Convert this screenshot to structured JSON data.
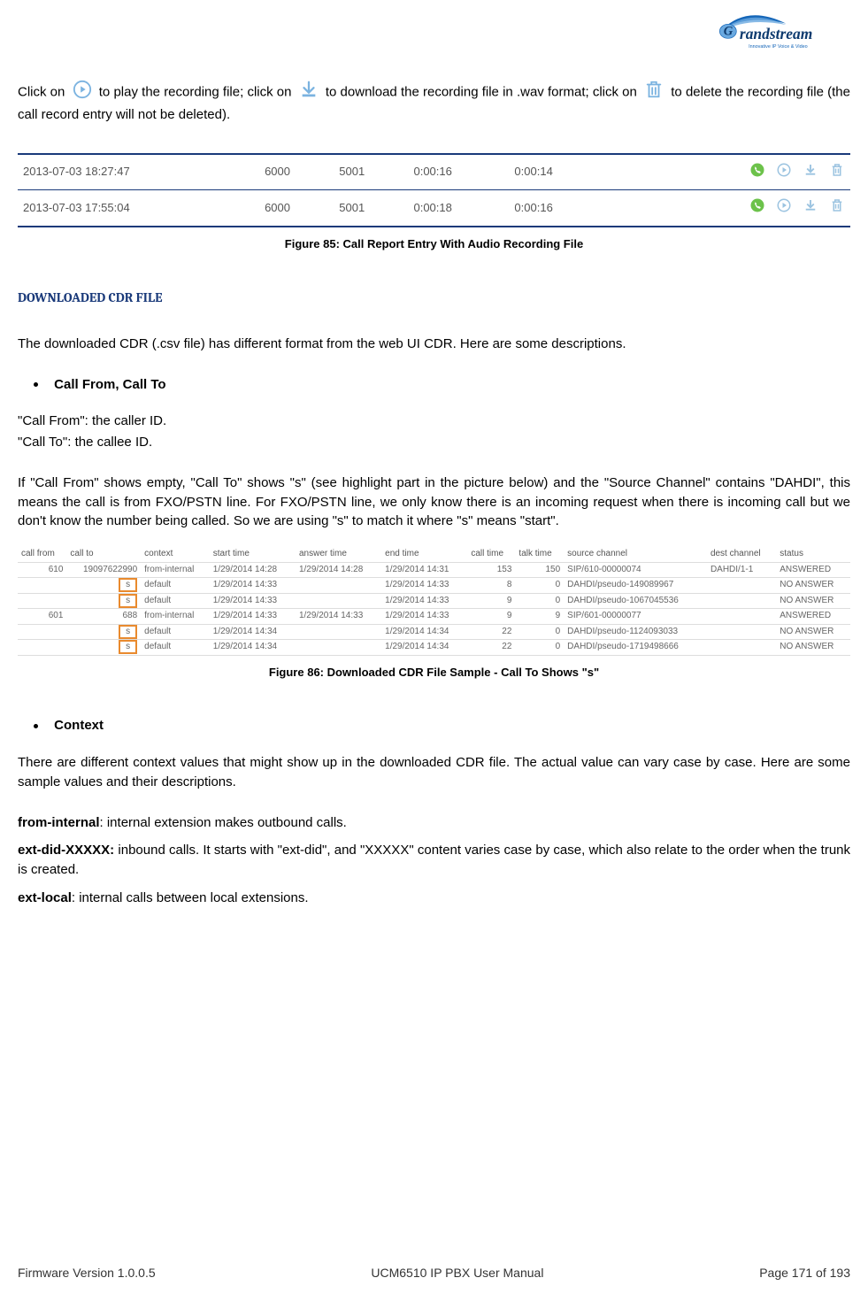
{
  "logo": {
    "brand": "Grandstream",
    "tagline": "Innovative IP Voice & Video"
  },
  "intro": {
    "t1": "Click on",
    "t2": " to play the recording file; click on",
    "t3": " to download the recording file in .wav format; click on",
    "t4": " to delete the recording file (the call record entry will not be deleted).",
    "icon_play": "play-circle-icon",
    "icon_download": "download-arrow-icon",
    "icon_delete": "trash-icon"
  },
  "fig85": {
    "caption": "Figure 85: Call Report Entry With Audio Recording File",
    "rows": [
      {
        "time": "2013-07-03 18:27:47",
        "from": "6000",
        "to": "5001",
        "d1": "0:00:16",
        "d2": "0:00:14"
      },
      {
        "time": "2013-07-03 17:55:04",
        "from": "6000",
        "to": "5001",
        "d1": "0:00:18",
        "d2": "0:00:16"
      }
    ]
  },
  "section": {
    "heading": "DOWNLOADED CDR FILE",
    "p1": "The downloaded CDR (.csv file) has different format from the web UI CDR. Here are some descriptions.",
    "bullet1": "Call From, Call To",
    "p2": "\"Call From\": the caller ID.",
    "p3": "\"Call To\": the callee ID.",
    "p4": "If \"Call From\" shows empty, \"Call To\" shows \"s\" (see highlight part in the picture below) and the \"Source Channel\" contains \"DAHDI\", this means the call is from FXO/PSTN line. For FXO/PSTN line, we only know there is an incoming request when there is incoming call but we don't know the number being called. So we are using \"s\" to match it where \"s\" means \"start\".",
    "bullet2": "Context",
    "p5": "There are different context values that might show up in the downloaded CDR file. The actual value can vary case by case. Here are some sample values and their descriptions.",
    "ctx1a": "from-internal",
    "ctx1b": ": internal extension makes outbound calls.",
    "ctx2a": "ext-did-XXXXX:",
    "ctx2b": " inbound calls. It starts with \"ext-did\", and \"XXXXX\" content varies case by case, which also relate to the order when the trunk is created.",
    "ctx3a": "ext-local",
    "ctx3b": ": internal calls between local extensions."
  },
  "fig86": {
    "caption": "Figure 86: Downloaded CDR File Sample - Call To Shows \"s\"",
    "headers": [
      "call from",
      "call to",
      "context",
      "start time",
      "answer time",
      "end time",
      "call time",
      "talk time",
      "source channel",
      "dest channel",
      "status"
    ],
    "rows": [
      {
        "from": "610",
        "to": "19097622990",
        "ctx": "from-internal",
        "st": "1/29/2014 14:28",
        "at": "1/29/2014 14:28",
        "et": "1/29/2014 14:31",
        "ct": "153",
        "tt": "150",
        "sc": "SIP/610-00000074",
        "dc": "DAHDI/1-1",
        "status": "ANSWERED",
        "hl": false
      },
      {
        "from": "",
        "to": "s",
        "ctx": "default",
        "st": "1/29/2014 14:33",
        "at": "",
        "et": "1/29/2014 14:33",
        "ct": "8",
        "tt": "0",
        "sc": "DAHDI/pseudo-149089967",
        "dc": "",
        "status": "NO ANSWER",
        "hl": true
      },
      {
        "from": "",
        "to": "s",
        "ctx": "default",
        "st": "1/29/2014 14:33",
        "at": "",
        "et": "1/29/2014 14:33",
        "ct": "9",
        "tt": "0",
        "sc": "DAHDI/pseudo-1067045536",
        "dc": "",
        "status": "NO ANSWER",
        "hl": true
      },
      {
        "from": "601",
        "to": "688",
        "ctx": "from-internal",
        "st": "1/29/2014 14:33",
        "at": "1/29/2014 14:33",
        "et": "1/29/2014 14:33",
        "ct": "9",
        "tt": "9",
        "sc": "SIP/601-00000077",
        "dc": "",
        "status": "ANSWERED",
        "hl": false
      },
      {
        "from": "",
        "to": "s",
        "ctx": "default",
        "st": "1/29/2014 14:34",
        "at": "",
        "et": "1/29/2014 14:34",
        "ct": "22",
        "tt": "0",
        "sc": "DAHDI/pseudo-1124093033",
        "dc": "",
        "status": "NO ANSWER",
        "hl": true
      },
      {
        "from": "",
        "to": "s",
        "ctx": "default",
        "st": "1/29/2014 14:34",
        "at": "",
        "et": "1/29/2014 14:34",
        "ct": "22",
        "tt": "0",
        "sc": "DAHDI/pseudo-1719498666",
        "dc": "",
        "status": "NO ANSWER",
        "hl": true
      }
    ]
  },
  "footer": {
    "left": "Firmware Version 1.0.0.5",
    "center": "UCM6510 IP PBX User Manual",
    "right": "Page 171 of 193"
  }
}
